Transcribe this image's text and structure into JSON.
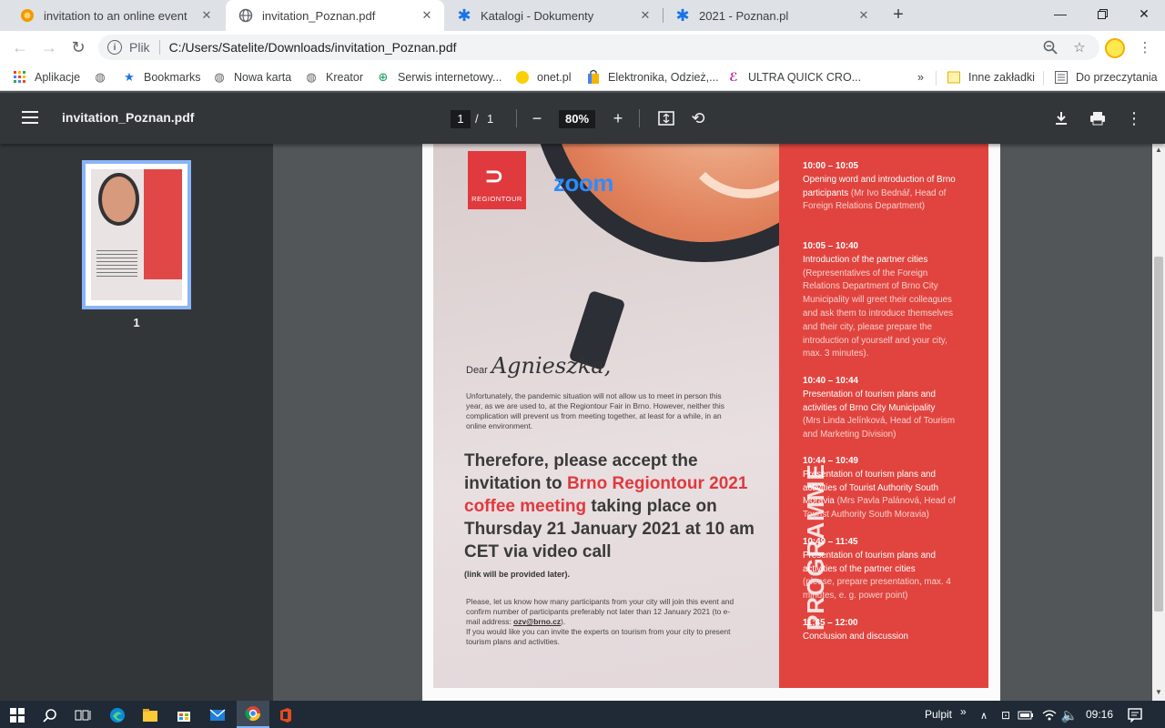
{
  "tabs": [
    {
      "label": "invitation to an online event",
      "icon": "orange-circle-icon"
    },
    {
      "label": "invitation_Poznan.pdf",
      "icon": "globe-icon"
    },
    {
      "label": "Katalogi - Dokumenty",
      "icon": "asterisk-icon"
    },
    {
      "label": "2021 - Poznan.pl",
      "icon": "asterisk-icon"
    }
  ],
  "omnibox": {
    "scheme": "Plik",
    "url": "C:/Users/Satelite/Downloads/invitation_Poznan.pdf"
  },
  "bookmarks": [
    {
      "label": "Aplikacje"
    },
    {
      "label": ""
    },
    {
      "label": "Bookmarks"
    },
    {
      "label": "Nowa karta"
    },
    {
      "label": "Kreator"
    },
    {
      "label": "Serwis internetowy..."
    },
    {
      "label": "onet.pl"
    },
    {
      "label": "Elektronika, Odzież,..."
    },
    {
      "label": "ULTRA QUICK CRO..."
    }
  ],
  "bookmarks_more": "»",
  "bookmarks_right": [
    {
      "label": "Inne zakładki"
    },
    {
      "label": "Do przeczytania"
    }
  ],
  "pdf": {
    "title": "invitation_Poznan.pdf",
    "page_current": "1",
    "page_sep": "/",
    "page_total": "1",
    "zoom": "80%",
    "thumb_label": "1"
  },
  "doc": {
    "rt_logo": "REGIONTOUR",
    "zoom_logo": "zoom",
    "dear": "Dear",
    "signature": "Agnieszka,",
    "para1": "Unfortunately, the pandemic situation will not allow us to meet in person this year, as we are used to, at the Regiontour Fair in Brno. However, neither this complication will prevent us from meeting together, at least for a while, in an online environment.",
    "head_a": "Therefore, please accept the invitation to ",
    "head_red": "Brno Regiontour 2021 coffee meeting",
    "head_b": " taking place on Thursday 21 January 2021 at 10 am CET via video call",
    "link_note": "(link will be provided later).",
    "para2_a": "Please, let us know how many participants from your city will join this event and confirm number of participants preferably not later than 12 January 2021 (to e-mail address: ",
    "para2_email": "ozv@brno.cz",
    "para2_b": ").",
    "para3": "If you would like you can invite the experts on tourism from your city to present tourism plans and activities.",
    "programme": "PROGRAMME",
    "items": [
      {
        "time": "10:00 – 10:05",
        "title": "Opening word and introduction of Brno participants",
        "note": " (Mr Ivo Bednář, Head of Foreign Relations Department)"
      },
      {
        "time": "10:05 – 10:40",
        "title": "Introduction of the partner cities",
        "note": "(Representatives of the Foreign Relations Department of Brno City Municipality will greet their colleagues and ask them to introduce themselves and their city, please prepare the introduction of yourself and your city, max. 3 minutes)."
      },
      {
        "time": "10:40 – 10:44",
        "title": "Presentation of tourism plans and activities of Brno City Municipality",
        "note": "(Mrs Linda Jelínková, Head of Tourism and Marketing Division)"
      },
      {
        "time": "10:44 – 10:49",
        "title": "Presentation of tourism plans and activities of Tourist Authority South Moravia",
        "note": " (Mrs Pavla Palánová, Head of Tourist Authority South Moravia)"
      },
      {
        "time": "10:49 – 11:45",
        "title": "Presentation of tourism plans and activities of the partner cities",
        "note": "(please, prepare presentation, max. 4 minutes, e. g. power point)"
      },
      {
        "time": "11:45 – 12:00",
        "title": "Conclusion and discussion",
        "note": ""
      }
    ]
  },
  "taskbar": {
    "label": "Pulpit",
    "chevron": "»",
    "time": "09:16"
  },
  "colors": {
    "accent": "#8ab4f8",
    "programme_red": "#e1443f",
    "pdf_toolbar": "#323639"
  }
}
